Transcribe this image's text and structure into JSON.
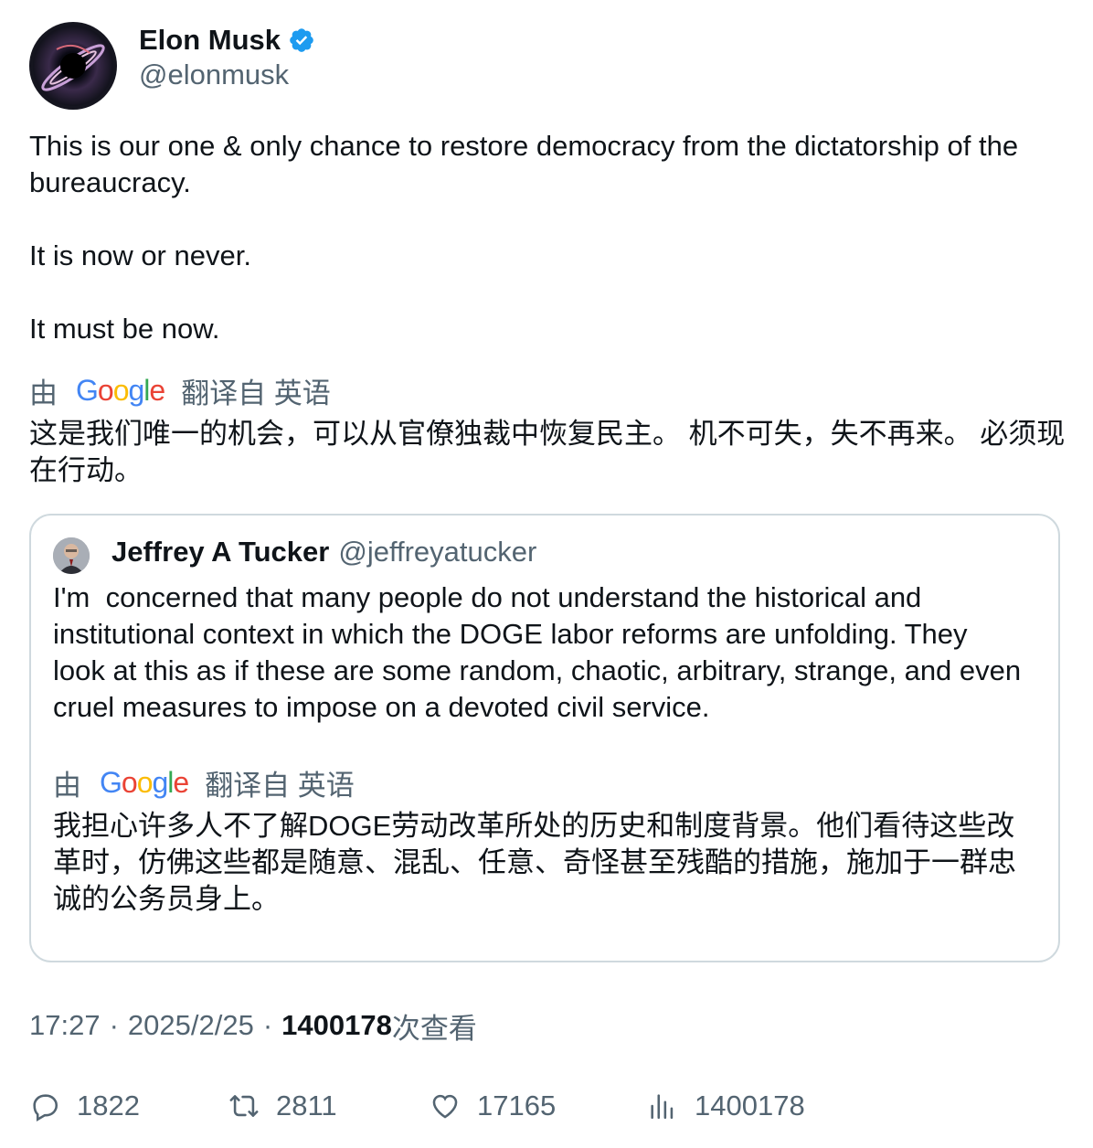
{
  "author": {
    "name": "Elon Musk",
    "handle": "@elonmusk",
    "verified": true,
    "verified_color": "#1d9bf0"
  },
  "tweet": {
    "text": "This is our one & only chance to restore democracy from the dictatorship of the bureaucracy.\n\nIt is now or never.\n\nIt must be now.",
    "translation_prefix": "由",
    "translation_suffix": "翻译自 英语",
    "translation_text": "这是我们唯一的机会，可以从官僚独裁中恢复民主。 机不可失，失不再来。 必须现在行动。"
  },
  "quote": {
    "name": "Jeffrey A Tucker",
    "handle": "@jeffreyatucker",
    "text": "I'm  concerned that many people do not understand the historical and institutional context in which the DOGE labor reforms are unfolding. They look at this as if these are some random, chaotic, arbitrary, strange, and even cruel measures to impose on a devoted civil service.",
    "translation_prefix": "由",
    "translation_suffix": "翻译自 英语",
    "translation_text": "我担心许多人不了解DOGE劳动改革所处的历史和制度背景。他们看待这些改革时，仿佛这些都是随意、混乱、任意、奇怪甚至残酷的措施，施加于一群忠诚的公务员身上。"
  },
  "meta": {
    "time": "17:27",
    "separator": "·",
    "date": "2025/2/25",
    "views": "1400178",
    "views_label": "次查看"
  },
  "actions": {
    "replies": "1822",
    "reposts": "2811",
    "likes": "17165",
    "views": "1400178"
  },
  "icons": {
    "reply": "reply-icon",
    "repost": "repost-icon",
    "like": "heart-icon",
    "views": "views-icon",
    "verified": "verified-badge-icon"
  }
}
